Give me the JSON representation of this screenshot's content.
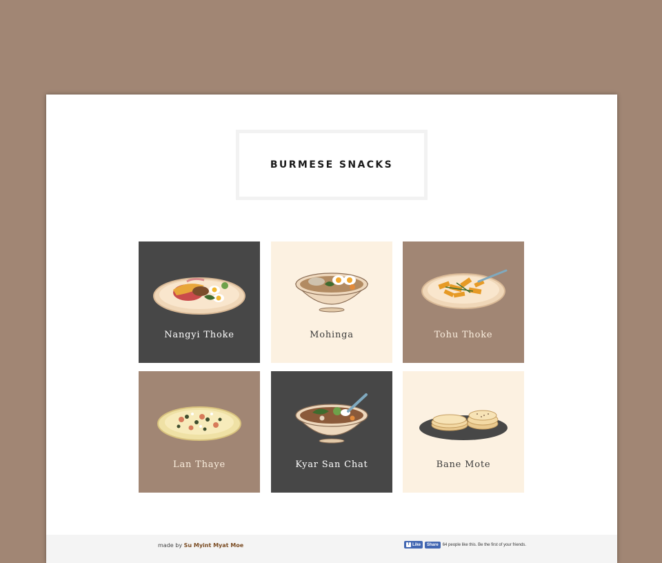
{
  "page": {
    "title": "BURMESE SNACKS"
  },
  "tiles": [
    {
      "label": "Nangyi Thoke",
      "image": "nangyi-thoke-plate-icon",
      "theme": "dark"
    },
    {
      "label": "Mohinga",
      "image": "mohinga-bowl-icon",
      "theme": "cream"
    },
    {
      "label": "Tohu Thoke",
      "image": "tohu-thoke-plate-icon",
      "theme": "brown"
    },
    {
      "label": "Lan Thaye",
      "image": "lan-thaye-pancake-icon",
      "theme": "brown"
    },
    {
      "label": "Kyar San Chat",
      "image": "kyar-san-chat-bowl-icon",
      "theme": "dark"
    },
    {
      "label": "Bane Mote",
      "image": "bane-mote-plate-icon",
      "theme": "cream"
    }
  ],
  "footer": {
    "made_by_prefix": "made by",
    "author": "Su Myint Myat Moe",
    "fb_like": "Like",
    "fb_share": "Share",
    "fb_text": "64 people like this. Be the first of your friends."
  },
  "colors": {
    "background": "#a18674",
    "dark_tile": "#474747",
    "cream_tile": "#fcf1e1",
    "brown_tile": "#a18674",
    "facebook_blue": "#4267b2",
    "author_link": "#7a4b22"
  }
}
